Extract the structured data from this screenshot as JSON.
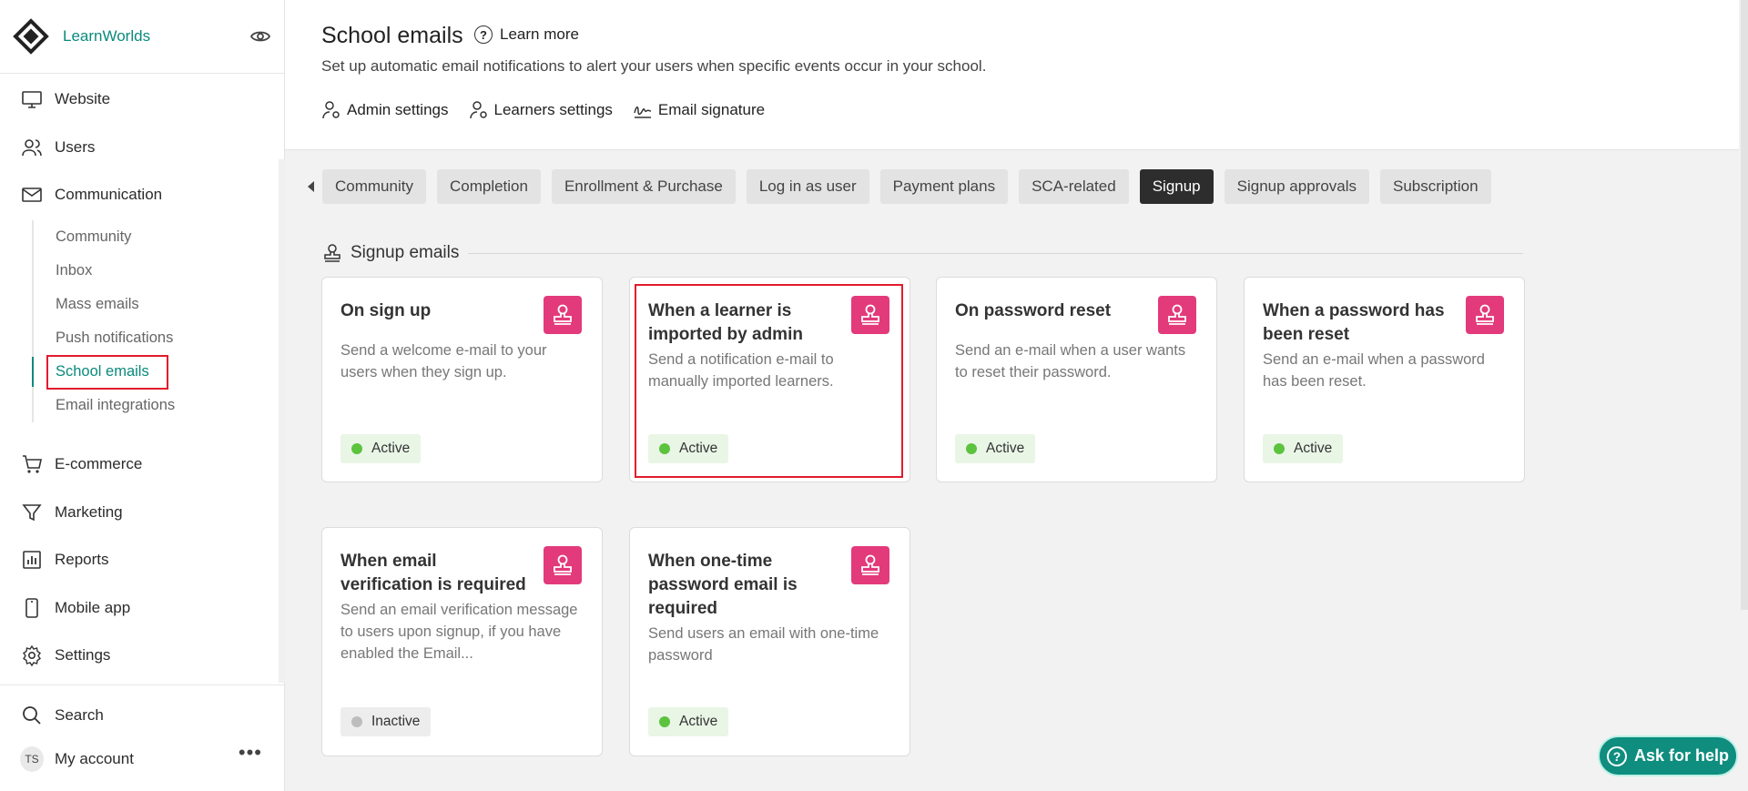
{
  "brand": {
    "name": "LearnWorlds"
  },
  "sidebar": {
    "main_items": [
      {
        "label": "Website",
        "icon": "monitor-icon"
      },
      {
        "label": "Users",
        "icon": "users-icon"
      },
      {
        "label": "Communication",
        "icon": "mail-icon"
      }
    ],
    "sub_items": [
      {
        "label": "Community"
      },
      {
        "label": "Inbox"
      },
      {
        "label": "Mass emails"
      },
      {
        "label": "Push notifications"
      },
      {
        "label": "School emails",
        "active": true
      },
      {
        "label": "Email integrations"
      }
    ],
    "lower_items": [
      {
        "label": "E-commerce",
        "icon": "cart-icon"
      },
      {
        "label": "Marketing",
        "icon": "funnel-icon"
      },
      {
        "label": "Reports",
        "icon": "chart-icon"
      },
      {
        "label": "Mobile app",
        "icon": "mobile-icon"
      },
      {
        "label": "Settings",
        "icon": "gear-icon"
      }
    ],
    "search_label": "Search",
    "account": {
      "initials": "TS",
      "label": "My account"
    }
  },
  "header": {
    "title": "School emails",
    "learn_more": "Learn more",
    "subtitle": "Set up automatic email notifications to alert your users when specific events occur in your school.",
    "links": [
      {
        "label": "Admin settings",
        "icon": "admin-settings-icon"
      },
      {
        "label": "Learners settings",
        "icon": "learner-settings-icon"
      },
      {
        "label": "Email signature",
        "icon": "signature-icon"
      }
    ]
  },
  "tabs": [
    {
      "label": "Community"
    },
    {
      "label": "Completion"
    },
    {
      "label": "Enrollment & Purchase"
    },
    {
      "label": "Log in as user"
    },
    {
      "label": "Payment plans"
    },
    {
      "label": "SCA-related"
    },
    {
      "label": "Signup",
      "active": true
    },
    {
      "label": "Signup approvals"
    },
    {
      "label": "Subscription"
    }
  ],
  "section": {
    "title": "Signup emails"
  },
  "cards": [
    {
      "title": "On sign up",
      "description": "Send a welcome e-mail to your users when they sign up.",
      "status": "Active"
    },
    {
      "title": "When a learner is imported by admin",
      "description": "Send a notification e-mail to manually imported learners.",
      "status": "Active"
    },
    {
      "title": "On password reset",
      "description": "Send an e-mail when a user wants to reset their password.",
      "status": "Active"
    },
    {
      "title": "When a password has been reset",
      "description": "Send an e-mail when a password has been reset.",
      "status": "Active"
    },
    {
      "title": "When email verification is required",
      "description": "Send an email verification message to users upon signup, if you have enabled the Email...",
      "status": "Inactive"
    },
    {
      "title": "When one-time password email is required",
      "description": "Send users an email with one-time password",
      "status": "Active"
    }
  ],
  "help_button": "Ask for help",
  "colors": {
    "brand_teal": "#0a8a7c",
    "card_icon_pink": "#e33a7b",
    "active_tab": "#2d2d2d",
    "active_dot": "#5cc33e",
    "highlight_red": "#e21b2c"
  }
}
